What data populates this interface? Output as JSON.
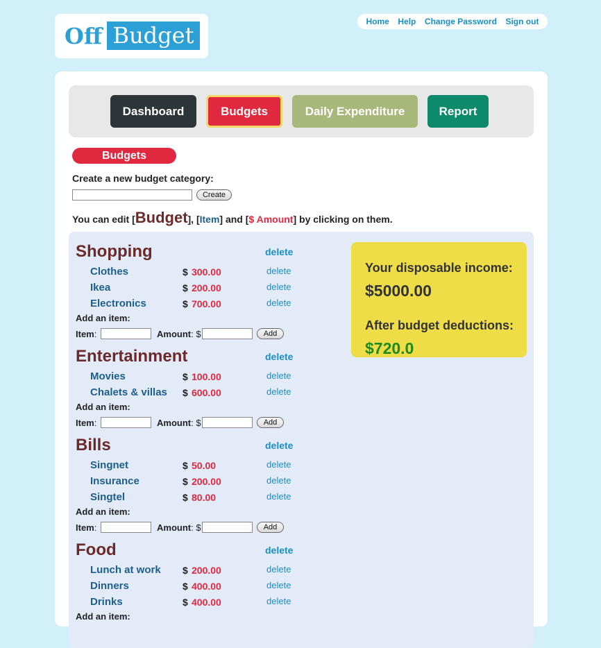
{
  "logo": {
    "part1": "Off",
    "part2": "Budget"
  },
  "topnav": [
    "Home",
    "Help",
    "Change Password",
    "Sign out"
  ],
  "tabs": [
    "Dashboard",
    "Budgets",
    "Daily Expenditure",
    "Report"
  ],
  "section_title": "Budgets",
  "create": {
    "label": "Create a new budget category:",
    "button": "Create",
    "value": ""
  },
  "hint": {
    "pre": "You can edit [",
    "budget": "Budget",
    "mid1": "], [",
    "item": "Item",
    "mid2": "] and [",
    "amount": "$ Amount",
    "post": "] by clicking on them."
  },
  "income": {
    "disposable_label": "Your disposable income:",
    "disposable_value": "$5000.00",
    "after_label": "After budget deductions:",
    "after_value": "$720.0",
    "colors": {
      "disposable": "#333333",
      "after": "#1d8a1d"
    }
  },
  "categories": [
    {
      "name": "Shopping",
      "delete": "delete",
      "items": [
        {
          "name": "Clothes",
          "dollar": "$",
          "amount": "300.00",
          "delete": "delete"
        },
        {
          "name": "Ikea",
          "dollar": "$",
          "amount": "200.00",
          "delete": "delete"
        },
        {
          "name": "Electronics",
          "dollar": "$",
          "amount": "700.00",
          "delete": "delete"
        }
      ]
    },
    {
      "name": "Entertainment",
      "delete": "delete",
      "items": [
        {
          "name": "Movies",
          "dollar": "$",
          "amount": "100.00",
          "delete": "delete"
        },
        {
          "name": "Chalets & villas",
          "dollar": "$",
          "amount": "600.00",
          "delete": "delete"
        }
      ]
    },
    {
      "name": "Bills",
      "delete": "delete",
      "items": [
        {
          "name": "Singnet",
          "dollar": "$",
          "amount": "50.00",
          "delete": "delete"
        },
        {
          "name": "Insurance",
          "dollar": "$",
          "amount": "200.00",
          "delete": "delete"
        },
        {
          "name": "Singtel",
          "dollar": "$",
          "amount": "80.00",
          "delete": "delete"
        }
      ]
    },
    {
      "name": "Food",
      "delete": "delete",
      "items": [
        {
          "name": "Lunch at work",
          "dollar": "$",
          "amount": "200.00",
          "delete": "delete"
        },
        {
          "name": "Dinners",
          "dollar": "$",
          "amount": "400.00",
          "delete": "delete"
        },
        {
          "name": "Drinks",
          "dollar": "$",
          "amount": "400.00",
          "delete": "delete"
        }
      ]
    }
  ],
  "add_form": {
    "heading": "Add an item:",
    "item_label": "Item",
    "amount_label": "Amount",
    "amount_prefix": "$",
    "button": "Add"
  }
}
